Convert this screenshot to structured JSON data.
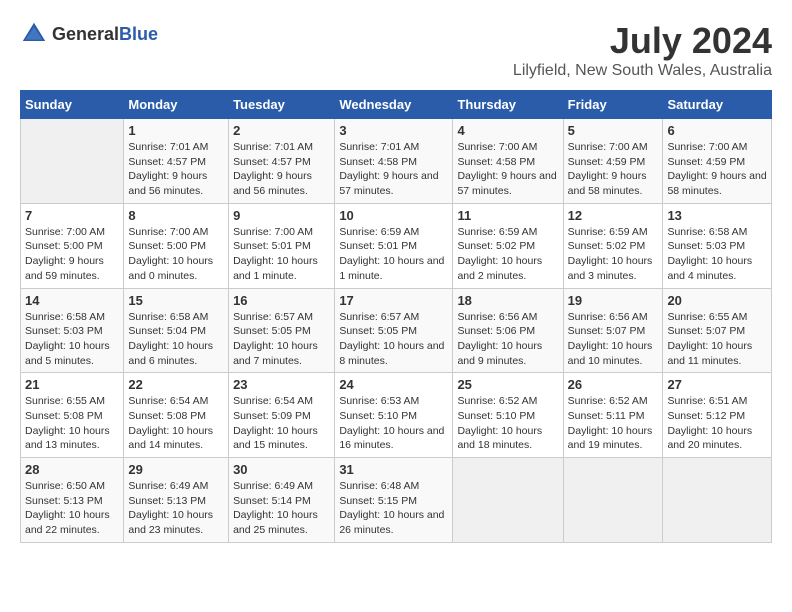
{
  "header": {
    "logo_general": "General",
    "logo_blue": "Blue",
    "title": "July 2024",
    "subtitle": "Lilyfield, New South Wales, Australia"
  },
  "calendar": {
    "days_of_week": [
      "Sunday",
      "Monday",
      "Tuesday",
      "Wednesday",
      "Thursday",
      "Friday",
      "Saturday"
    ],
    "weeks": [
      [
        {
          "day": "",
          "sunrise": "",
          "sunset": "",
          "daylight": "",
          "empty": true
        },
        {
          "day": "1",
          "sunrise": "Sunrise: 7:01 AM",
          "sunset": "Sunset: 4:57 PM",
          "daylight": "Daylight: 9 hours and 56 minutes."
        },
        {
          "day": "2",
          "sunrise": "Sunrise: 7:01 AM",
          "sunset": "Sunset: 4:57 PM",
          "daylight": "Daylight: 9 hours and 56 minutes."
        },
        {
          "day": "3",
          "sunrise": "Sunrise: 7:01 AM",
          "sunset": "Sunset: 4:58 PM",
          "daylight": "Daylight: 9 hours and 57 minutes."
        },
        {
          "day": "4",
          "sunrise": "Sunrise: 7:00 AM",
          "sunset": "Sunset: 4:58 PM",
          "daylight": "Daylight: 9 hours and 57 minutes."
        },
        {
          "day": "5",
          "sunrise": "Sunrise: 7:00 AM",
          "sunset": "Sunset: 4:59 PM",
          "daylight": "Daylight: 9 hours and 58 minutes."
        },
        {
          "day": "6",
          "sunrise": "Sunrise: 7:00 AM",
          "sunset": "Sunset: 4:59 PM",
          "daylight": "Daylight: 9 hours and 58 minutes."
        }
      ],
      [
        {
          "day": "7",
          "sunrise": "Sunrise: 7:00 AM",
          "sunset": "Sunset: 5:00 PM",
          "daylight": "Daylight: 9 hours and 59 minutes."
        },
        {
          "day": "8",
          "sunrise": "Sunrise: 7:00 AM",
          "sunset": "Sunset: 5:00 PM",
          "daylight": "Daylight: 10 hours and 0 minutes."
        },
        {
          "day": "9",
          "sunrise": "Sunrise: 7:00 AM",
          "sunset": "Sunset: 5:01 PM",
          "daylight": "Daylight: 10 hours and 1 minute."
        },
        {
          "day": "10",
          "sunrise": "Sunrise: 6:59 AM",
          "sunset": "Sunset: 5:01 PM",
          "daylight": "Daylight: 10 hours and 1 minute."
        },
        {
          "day": "11",
          "sunrise": "Sunrise: 6:59 AM",
          "sunset": "Sunset: 5:02 PM",
          "daylight": "Daylight: 10 hours and 2 minutes."
        },
        {
          "day": "12",
          "sunrise": "Sunrise: 6:59 AM",
          "sunset": "Sunset: 5:02 PM",
          "daylight": "Daylight: 10 hours and 3 minutes."
        },
        {
          "day": "13",
          "sunrise": "Sunrise: 6:58 AM",
          "sunset": "Sunset: 5:03 PM",
          "daylight": "Daylight: 10 hours and 4 minutes."
        }
      ],
      [
        {
          "day": "14",
          "sunrise": "Sunrise: 6:58 AM",
          "sunset": "Sunset: 5:03 PM",
          "daylight": "Daylight: 10 hours and 5 minutes."
        },
        {
          "day": "15",
          "sunrise": "Sunrise: 6:58 AM",
          "sunset": "Sunset: 5:04 PM",
          "daylight": "Daylight: 10 hours and 6 minutes."
        },
        {
          "day": "16",
          "sunrise": "Sunrise: 6:57 AM",
          "sunset": "Sunset: 5:05 PM",
          "daylight": "Daylight: 10 hours and 7 minutes."
        },
        {
          "day": "17",
          "sunrise": "Sunrise: 6:57 AM",
          "sunset": "Sunset: 5:05 PM",
          "daylight": "Daylight: 10 hours and 8 minutes."
        },
        {
          "day": "18",
          "sunrise": "Sunrise: 6:56 AM",
          "sunset": "Sunset: 5:06 PM",
          "daylight": "Daylight: 10 hours and 9 minutes."
        },
        {
          "day": "19",
          "sunrise": "Sunrise: 6:56 AM",
          "sunset": "Sunset: 5:07 PM",
          "daylight": "Daylight: 10 hours and 10 minutes."
        },
        {
          "day": "20",
          "sunrise": "Sunrise: 6:55 AM",
          "sunset": "Sunset: 5:07 PM",
          "daylight": "Daylight: 10 hours and 11 minutes."
        }
      ],
      [
        {
          "day": "21",
          "sunrise": "Sunrise: 6:55 AM",
          "sunset": "Sunset: 5:08 PM",
          "daylight": "Daylight: 10 hours and 13 minutes."
        },
        {
          "day": "22",
          "sunrise": "Sunrise: 6:54 AM",
          "sunset": "Sunset: 5:08 PM",
          "daylight": "Daylight: 10 hours and 14 minutes."
        },
        {
          "day": "23",
          "sunrise": "Sunrise: 6:54 AM",
          "sunset": "Sunset: 5:09 PM",
          "daylight": "Daylight: 10 hours and 15 minutes."
        },
        {
          "day": "24",
          "sunrise": "Sunrise: 6:53 AM",
          "sunset": "Sunset: 5:10 PM",
          "daylight": "Daylight: 10 hours and 16 minutes."
        },
        {
          "day": "25",
          "sunrise": "Sunrise: 6:52 AM",
          "sunset": "Sunset: 5:10 PM",
          "daylight": "Daylight: 10 hours and 18 minutes."
        },
        {
          "day": "26",
          "sunrise": "Sunrise: 6:52 AM",
          "sunset": "Sunset: 5:11 PM",
          "daylight": "Daylight: 10 hours and 19 minutes."
        },
        {
          "day": "27",
          "sunrise": "Sunrise: 6:51 AM",
          "sunset": "Sunset: 5:12 PM",
          "daylight": "Daylight: 10 hours and 20 minutes."
        }
      ],
      [
        {
          "day": "28",
          "sunrise": "Sunrise: 6:50 AM",
          "sunset": "Sunset: 5:13 PM",
          "daylight": "Daylight: 10 hours and 22 minutes."
        },
        {
          "day": "29",
          "sunrise": "Sunrise: 6:49 AM",
          "sunset": "Sunset: 5:13 PM",
          "daylight": "Daylight: 10 hours and 23 minutes."
        },
        {
          "day": "30",
          "sunrise": "Sunrise: 6:49 AM",
          "sunset": "Sunset: 5:14 PM",
          "daylight": "Daylight: 10 hours and 25 minutes."
        },
        {
          "day": "31",
          "sunrise": "Sunrise: 6:48 AM",
          "sunset": "Sunset: 5:15 PM",
          "daylight": "Daylight: 10 hours and 26 minutes."
        },
        {
          "day": "",
          "sunrise": "",
          "sunset": "",
          "daylight": "",
          "empty": true
        },
        {
          "day": "",
          "sunrise": "",
          "sunset": "",
          "daylight": "",
          "empty": true
        },
        {
          "day": "",
          "sunrise": "",
          "sunset": "",
          "daylight": "",
          "empty": true
        }
      ]
    ]
  }
}
